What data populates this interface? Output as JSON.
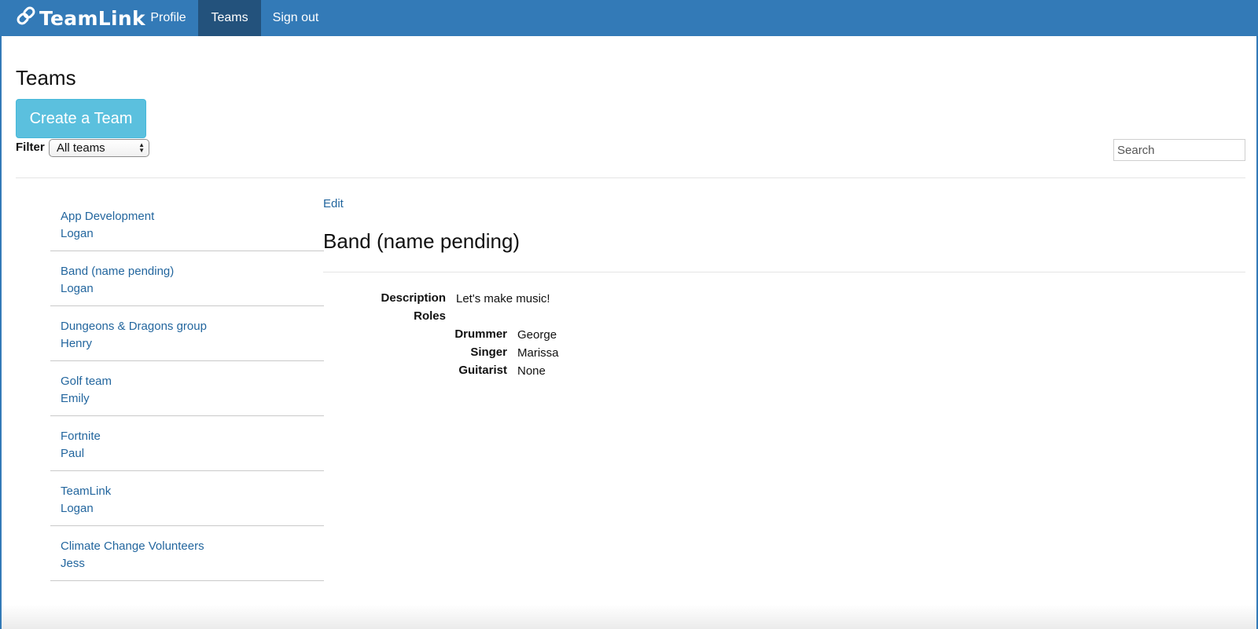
{
  "navbar": {
    "brand": "TeamLink",
    "items": [
      {
        "label": "Profile"
      },
      {
        "label": "Teams"
      },
      {
        "label": "Sign out"
      }
    ]
  },
  "page": {
    "title": "Teams",
    "create_button": "Create a Team",
    "filter_label": "Filter",
    "filter_selected": "All teams",
    "search_placeholder": "Search"
  },
  "teams": [
    {
      "name": "App Development",
      "owner": "Logan"
    },
    {
      "name": "Band (name pending)",
      "owner": "Logan"
    },
    {
      "name": "Dungeons & Dragons group",
      "owner": "Henry"
    },
    {
      "name": "Golf team",
      "owner": "Emily"
    },
    {
      "name": "Fortnite",
      "owner": "Paul"
    },
    {
      "name": "TeamLink",
      "owner": "Logan"
    },
    {
      "name": "Climate Change Volunteers",
      "owner": "Jess"
    }
  ],
  "detail": {
    "edit_label": "Edit",
    "title": "Band (name pending)",
    "description_label": "Description",
    "description": "Let's make music!",
    "roles_label": "Roles",
    "roles": [
      {
        "role": "Drummer",
        "member": "George"
      },
      {
        "role": "Singer",
        "member": "Marissa"
      },
      {
        "role": "Guitarist",
        "member": "None"
      }
    ]
  },
  "colors": {
    "navbar": "#337ab7",
    "nav_active": "#23527c",
    "create_button": "#5bc0de",
    "link": "#23669e"
  },
  "icons": {
    "brand": "link-icon"
  }
}
